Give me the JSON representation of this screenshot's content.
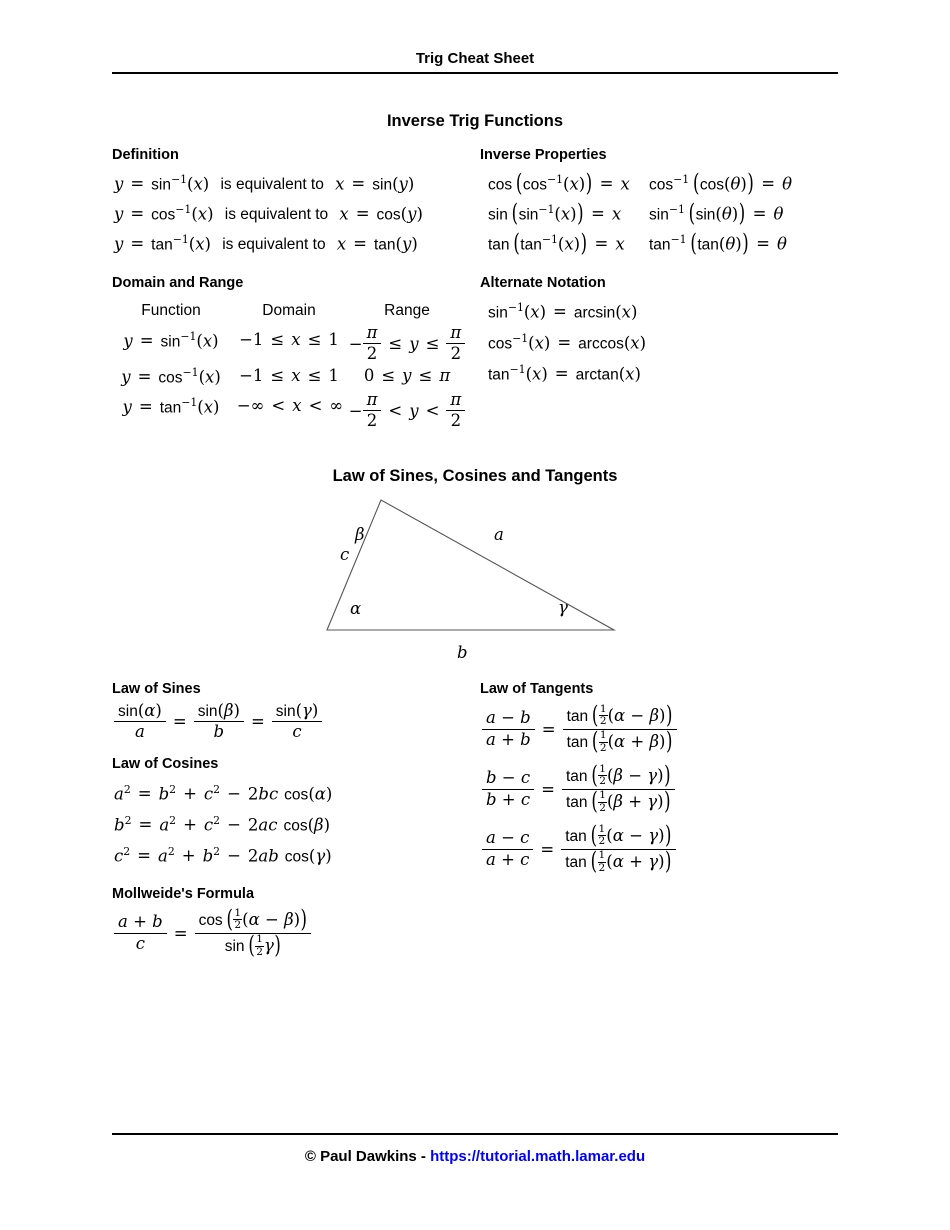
{
  "header": {
    "title": "Trig Cheat Sheet"
  },
  "footer": {
    "copyright": "© Paul Dawkins - ",
    "url": "https://tutorial.math.lamar.edu",
    "link_color": "#0000FF"
  },
  "sections": {
    "inverse_trig": {
      "title": "Inverse Trig Functions",
      "definition": {
        "heading": "Definition",
        "rows": [
          {
            "left_var": "y",
            "left_fn": "sin",
            "connector": "is equivalent to",
            "right_var": "x",
            "right_fn": "sin",
            "right_arg": "y"
          },
          {
            "left_var": "y",
            "left_fn": "cos",
            "connector": "is equivalent to",
            "right_var": "x",
            "right_fn": "cos",
            "right_arg": "y"
          },
          {
            "left_var": "y",
            "left_fn": "tan",
            "connector": "is equivalent to",
            "right_var": "x",
            "right_fn": "tan",
            "right_arg": "y"
          }
        ]
      },
      "inverse_properties": {
        "heading": "Inverse Properties",
        "left_column": [
          {
            "outer": "cos",
            "inner": "cos",
            "arg": "x",
            "result": "x"
          },
          {
            "outer": "sin",
            "inner": "sin",
            "arg": "x",
            "result": "x"
          },
          {
            "outer": "tan",
            "inner": "tan",
            "arg": "x",
            "result": "x"
          }
        ],
        "right_column": [
          {
            "outer": "cos",
            "inner": "cos",
            "arg": "θ",
            "result": "θ"
          },
          {
            "outer": "sin",
            "inner": "sin",
            "arg": "θ",
            "result": "θ"
          },
          {
            "outer": "tan",
            "inner": "tan",
            "arg": "θ",
            "result": "θ"
          }
        ]
      },
      "domain_and_range": {
        "heading": "Domain and Range",
        "columns": [
          "Function",
          "Domain",
          "Range"
        ],
        "rows": [
          {
            "fn": "sin",
            "domain": "−1 ≤ x ≤ 1",
            "range_type": "frac",
            "range_left_sign": "−",
            "range_rel": "≤",
            "range_num": "π",
            "range_den": "2",
            "range_var": "y"
          },
          {
            "fn": "cos",
            "domain": "−1 ≤ x ≤ 1",
            "range_type": "plain",
            "range_text": "0 ≤ y ≤ π"
          },
          {
            "fn": "tan",
            "domain": "−∞ < x < ∞",
            "range_type": "frac",
            "range_left_sign": "−",
            "range_rel": "<",
            "range_num": "π",
            "range_den": "2",
            "range_var": "y"
          }
        ]
      },
      "alternate_notation": {
        "heading": "Alternate Notation",
        "rows": [
          {
            "fn": "sin",
            "arg": "x",
            "alt": "arcsin"
          },
          {
            "fn": "cos",
            "arg": "x",
            "alt": "arccos"
          },
          {
            "fn": "tan",
            "arg": "x",
            "alt": "arctan"
          }
        ]
      }
    },
    "laws": {
      "title": "Law of Sines, Cosines and Tangents",
      "triangle": {
        "angle_bottom_left": "α",
        "angle_apex": "β",
        "angle_bottom_right": "γ",
        "side_left": "c",
        "side_upper_right": "a",
        "side_bottom": "b"
      },
      "law_of_sines": {
        "heading": "Law of Sines",
        "terms": [
          {
            "num_fn": "sin",
            "num_arg": "α",
            "den": "a"
          },
          {
            "num_fn": "sin",
            "num_arg": "β",
            "den": "b"
          },
          {
            "num_fn": "sin",
            "num_arg": "γ",
            "den": "c"
          }
        ]
      },
      "law_of_cosines": {
        "heading": "Law of Cosines",
        "rows": [
          {
            "lhs": "a",
            "t1": "b",
            "t2": "c",
            "prod": "2bc",
            "fn": "cos",
            "angle": "α"
          },
          {
            "lhs": "b",
            "t1": "a",
            "t2": "c",
            "prod": "2ac",
            "fn": "cos",
            "angle": "β"
          },
          {
            "lhs": "c",
            "t1": "a",
            "t2": "b",
            "prod": "2ab",
            "fn": "cos",
            "angle": "γ"
          }
        ]
      },
      "law_of_tangents": {
        "heading": "Law of Tangents",
        "rows": [
          {
            "lhs_num": "a − b",
            "lhs_den": "a + b",
            "fn": "tan",
            "half_num": "1",
            "half_den": "2",
            "num_angles": "α − β",
            "den_angles": "α + β"
          },
          {
            "lhs_num": "b − c",
            "lhs_den": "b + c",
            "fn": "tan",
            "half_num": "1",
            "half_den": "2",
            "num_angles": "β − γ",
            "den_angles": "β + γ"
          },
          {
            "lhs_num": "a − c",
            "lhs_den": "a + c",
            "fn": "tan",
            "half_num": "1",
            "half_den": "2",
            "num_angles": "α − γ",
            "den_angles": "α + γ"
          }
        ]
      },
      "mollweide": {
        "heading": "Mollweide's Formula",
        "lhs_num": "a + b",
        "lhs_den": "c",
        "num_fn": "cos",
        "num_half_num": "1",
        "num_half_den": "2",
        "num_angles": "α − β",
        "den_fn": "sin",
        "den_half_num": "1",
        "den_half_den": "2",
        "den_angle": "γ"
      }
    }
  },
  "symbols": {
    "inverse_exp": "−1",
    "equals": "=",
    "minus": "−",
    "plus": "+",
    "squared": "2"
  }
}
